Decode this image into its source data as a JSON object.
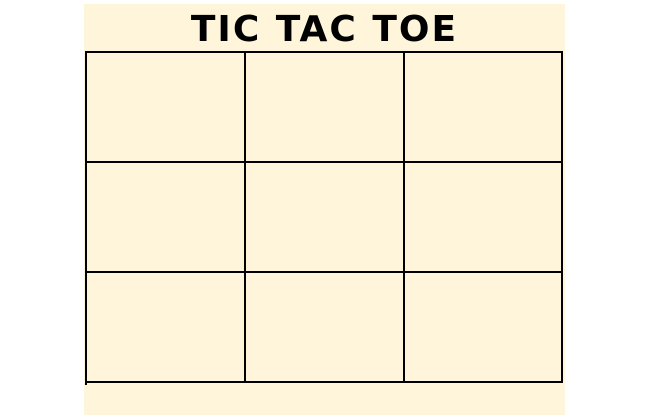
{
  "game": {
    "title": "TIC TAC TOE"
  },
  "board": {
    "cells": [
      "",
      "",
      "",
      "",
      "",
      "",
      "",
      "",
      ""
    ]
  },
  "colors": {
    "panel_background": "#fff5db",
    "grid_lines": "#000000",
    "page_background": "#ffffff"
  }
}
